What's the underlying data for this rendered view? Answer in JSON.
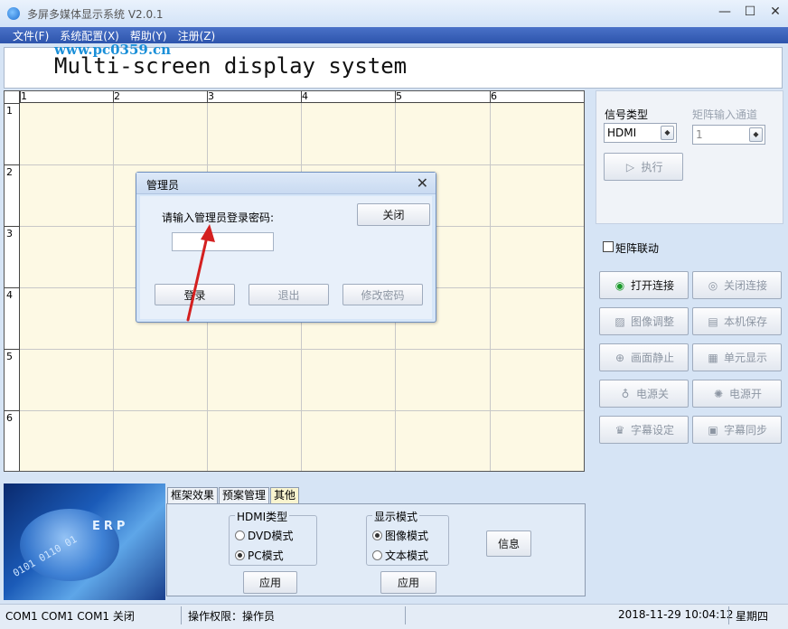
{
  "window": {
    "title": "多屏多媒体显示系统 V2.0.1",
    "minimize_glyph": "—",
    "maximize_glyph": "☐",
    "close_glyph": "✕"
  },
  "menu": {
    "items": [
      "文件(F)",
      "系统配置(X)",
      "帮助(Y)",
      "注册(Z)"
    ]
  },
  "watermark": "www.pc0359.cn",
  "header": {
    "title": "Multi-screen display system"
  },
  "grid": {
    "columns": [
      "1",
      "2",
      "3",
      "4",
      "5",
      "6"
    ],
    "rows": [
      "1",
      "2",
      "3",
      "4",
      "5",
      "6"
    ]
  },
  "right_panel": {
    "signal_type_label": "信号类型",
    "signal_type_value": "HDMI",
    "matrix_input_label": "矩阵输入通道",
    "matrix_input_value": "1",
    "execute_label": "执行",
    "matrix_link_label": "矩阵联动",
    "matrix_link_checked": false,
    "buttons": [
      {
        "label": "打开连接",
        "icon": "connect-icon",
        "glyph": "◉",
        "enabled": true
      },
      {
        "label": "关闭连接",
        "icon": "disconnect-icon",
        "glyph": "◎",
        "enabled": false
      },
      {
        "label": "图像调整",
        "icon": "image-adjust-icon",
        "glyph": "▨",
        "enabled": false
      },
      {
        "label": "本机保存",
        "icon": "save-icon",
        "glyph": "▤",
        "enabled": false
      },
      {
        "label": "画面静止",
        "icon": "lock-icon",
        "glyph": "⊕",
        "enabled": false
      },
      {
        "label": "单元显示",
        "icon": "grid-icon",
        "glyph": "▦",
        "enabled": false
      },
      {
        "label": "电源关",
        "icon": "bulb-off-icon",
        "glyph": "♁",
        "enabled": false
      },
      {
        "label": "电源开",
        "icon": "bulb-on-icon",
        "glyph": "✺",
        "enabled": false
      },
      {
        "label": "字幕设定",
        "icon": "caption-set-icon",
        "glyph": "♛",
        "enabled": false
      },
      {
        "label": "字幕同步",
        "icon": "caption-sync-icon",
        "glyph": "▣",
        "enabled": false
      }
    ]
  },
  "bottom": {
    "banner_text": "ERP",
    "banner_bits": "0101 0110 01",
    "tabs": [
      "框架效果",
      "预案管理",
      "其他"
    ],
    "active_tab": "其他",
    "hdmi_group": {
      "title": "HDMI类型",
      "options": [
        {
          "label": "DVD模式",
          "selected": false
        },
        {
          "label": "PC模式",
          "selected": true
        }
      ],
      "apply_label": "应用"
    },
    "display_group": {
      "title": "显示模式",
      "options": [
        {
          "label": "图像模式",
          "selected": true
        },
        {
          "label": "文本模式",
          "selected": false
        }
      ],
      "apply_label": "应用"
    },
    "info_label": "信息"
  },
  "status": {
    "ports": "COM1 COM1 COM1 关闭",
    "permission": "操作权限：操作员",
    "datetime": "2018-11-29 10:04:12",
    "weekday": "星期四"
  },
  "dialog": {
    "title": "管理员",
    "close_glyph": "✕",
    "prompt": "请输入管理员登录密码:",
    "password_value": "",
    "close_label": "关闭",
    "login_label": "登录",
    "exit_label": "退出",
    "change_password_label": "修改密码"
  },
  "colors": {
    "menu_bar": "#2d54ac",
    "grid_background": "#fdf9e4",
    "arrow": "#d42020",
    "active_tab": "#f9f4cf"
  }
}
